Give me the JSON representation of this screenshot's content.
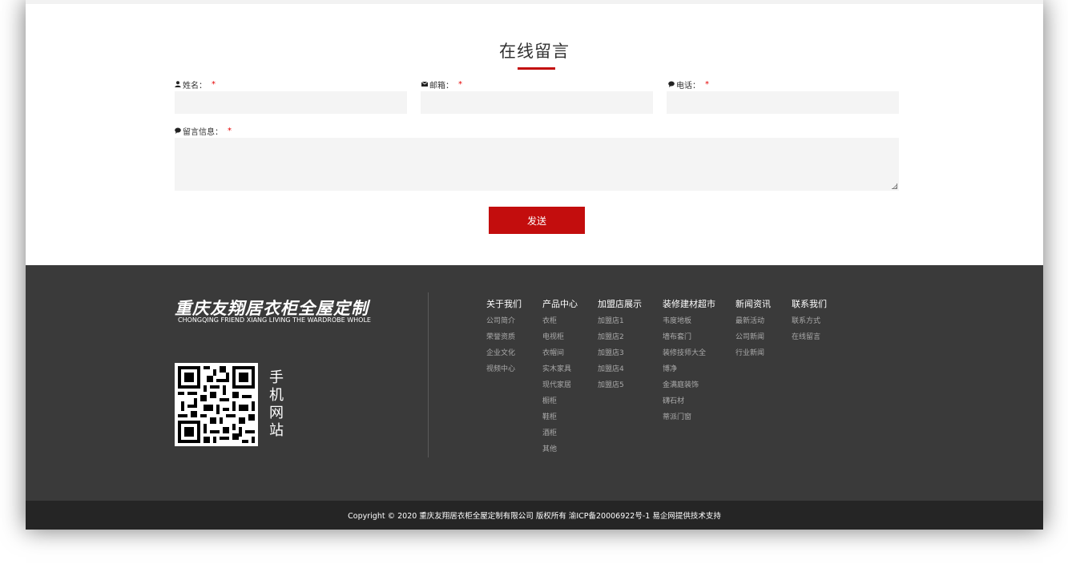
{
  "message_section": {
    "title": "在线留言",
    "name_label": "姓名：",
    "email_label": "邮箱：",
    "phone_label": "电话：",
    "message_label": "留言信息：",
    "required_mark": "*",
    "send_button": "发送",
    "accent_color": "#c30d0d"
  },
  "footer": {
    "brand_cn": "重庆友翔居衣柜全屋定制",
    "brand_en": "CHONGQING FRIEND XIANG LIVING THE WARDROBE WHOLE",
    "mobile_site": [
      "手",
      "机",
      "网",
      "站"
    ],
    "nav": [
      {
        "head": "关于我们",
        "items": [
          "公司简介",
          "荣誉资质",
          "企业文化",
          "视频中心"
        ]
      },
      {
        "head": "产品中心",
        "items": [
          "衣柜",
          "电视柜",
          "衣帽间",
          "实木家具",
          "现代家居",
          "橱柜",
          "鞋柜",
          "酒柜",
          "其他"
        ]
      },
      {
        "head": "加盟店展示",
        "items": [
          "加盟店1",
          "加盟店2",
          "加盟店3",
          "加盟店4",
          "加盟店5"
        ]
      },
      {
        "head": "装修建材超市",
        "items": [
          "韦度地板",
          "墙布套门",
          "装修技师大全",
          "博净",
          "金满庭装饰",
          "礴石材",
          "蒂派门窗"
        ]
      },
      {
        "head": "新闻资讯",
        "items": [
          "最新活动",
          "公司新闻",
          "行业新闻"
        ]
      },
      {
        "head": "联系我们",
        "items": [
          "联系方式",
          "在线留言"
        ]
      }
    ],
    "copyright": "Copyright © 2020 重庆友翔居衣柜全屋定制有限公司 版权所有 渝ICP备20006922号-1 易企网提供技术支持"
  }
}
